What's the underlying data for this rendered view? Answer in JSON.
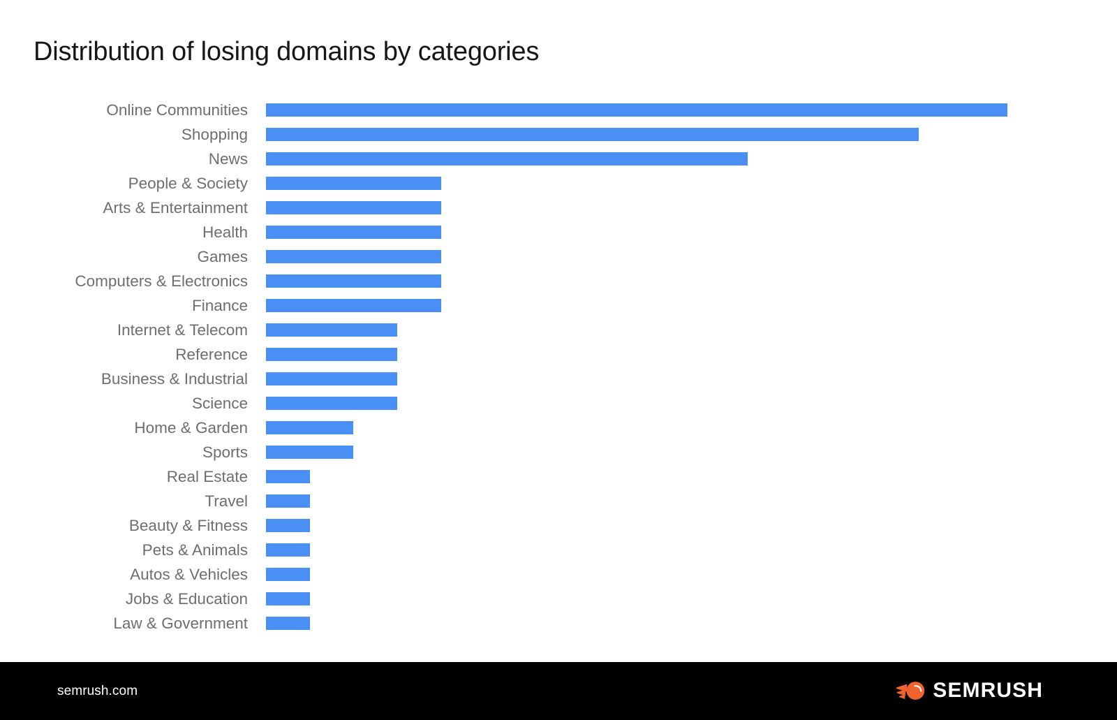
{
  "title": "Distribution of losing domains by categories",
  "colors": {
    "bar": "#4a90f4",
    "label": "#6e6e6e",
    "title": "#161616",
    "footer_background": "#000000",
    "footer_text": "#ffffff",
    "brand_orange": "#ef632f"
  },
  "footer": {
    "site": "semrush.com",
    "brand": "SEMRUSH",
    "brand_icon": "semrush-comet-icon"
  },
  "chart_data": {
    "type": "bar",
    "orientation": "horizontal",
    "title": "Distribution of losing domains by categories",
    "xlabel": "",
    "ylabel": "",
    "grid": false,
    "legend": "none",
    "axis_labels_visible": false,
    "value_unit": "share of losing domains (relative)",
    "xlim": [
      0,
      100
    ],
    "categories": [
      "Online Communities",
      "Shopping",
      "News",
      "People & Society",
      "Arts & Entertainment",
      "Health",
      "Games",
      "Computers & Electronics",
      "Finance",
      "Internet & Telecom",
      "Reference",
      "Business & Industrial",
      "Science",
      "Home & Garden",
      "Sports",
      "Real Estate",
      "Travel",
      "Beauty & Fitness",
      "Pets & Animals",
      "Autos & Vehicles",
      "Jobs & Education",
      "Law & Government"
    ],
    "values": [
      100,
      88,
      65,
      23.6,
      23.6,
      23.6,
      23.6,
      23.6,
      23.6,
      17.7,
      17.7,
      17.7,
      17.7,
      11.8,
      11.8,
      5.9,
      5.9,
      5.9,
      5.9,
      5.9,
      5.9,
      5.9
    ]
  }
}
